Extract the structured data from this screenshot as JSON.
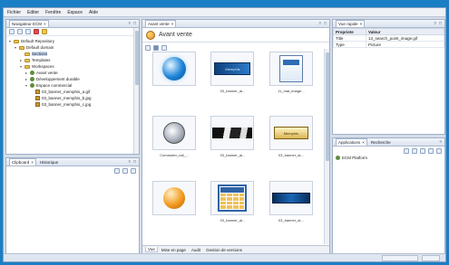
{
  "menubar": {
    "items": [
      "Fichier",
      "Editer",
      "Fenêtre",
      "Espace",
      "Aide"
    ]
  },
  "left_top": {
    "tab_label": "Navigateur ECM",
    "tree": [
      {
        "label": "Default Repository",
        "depth": 0,
        "twisty": "▾",
        "icon": "folder-icon"
      },
      {
        "label": "Default domain",
        "depth": 1,
        "twisty": "▾",
        "icon": "folder-icon"
      },
      {
        "label": "Sections",
        "depth": 2,
        "twisty": "",
        "icon": "folder-icon",
        "selected": true
      },
      {
        "label": "Templates",
        "depth": 2,
        "twisty": "▸",
        "icon": "folder-icon"
      },
      {
        "label": "Workspaces",
        "depth": 2,
        "twisty": "▾",
        "icon": "folder-icon"
      },
      {
        "label": "Avant vente",
        "depth": 3,
        "twisty": "▸",
        "icon": "gear-icon"
      },
      {
        "label": "Développement durable",
        "depth": 3,
        "twisty": "▸",
        "icon": "gear-icon"
      },
      {
        "label": "Espace commercial",
        "depth": 3,
        "twisty": "▾",
        "icon": "gear-icon"
      },
      {
        "label": "03_banner_memphis_a.gif",
        "depth": 4,
        "twisty": "",
        "icon": "image-icon"
      },
      {
        "label": "03_banner_memphis_b.jpg",
        "depth": 4,
        "twisty": "",
        "icon": "image-icon"
      },
      {
        "label": "03_banner_memphis_c.jpg",
        "depth": 4,
        "twisty": "",
        "icon": "image-icon"
      }
    ]
  },
  "left_bottom": {
    "tabs": [
      "Clipboard",
      "Historique"
    ]
  },
  "center": {
    "tab_label": "Avant vente",
    "title": "Avant vente",
    "thumbnails": [
      {
        "kind": "sphere",
        "caption": ""
      },
      {
        "kind": "banner",
        "caption": "03_banner_ai...",
        "banner_text": "Memphis"
      },
      {
        "kind": "doc",
        "caption": "11_mat_image..."
      },
      {
        "kind": "disc",
        "caption": "Commuter_rail_..."
      },
      {
        "kind": "bwbar",
        "caption": "03_banner_ai..."
      },
      {
        "kind": "goldplate",
        "caption": "03_banner_ai...",
        "banner_text": "Memphis"
      },
      {
        "kind": "orb",
        "caption": ""
      },
      {
        "kind": "calwin",
        "caption": "03_banner_ai..."
      },
      {
        "kind": "bluebar",
        "caption": "03_banner_ai..."
      }
    ],
    "bottom_tabs": [
      "Vue",
      "Mise en page",
      "Audit",
      "Gestion de versions"
    ]
  },
  "right_top": {
    "tab_label": "Vue rapide",
    "columns": [
      "Propriete",
      "Valeur"
    ],
    "rows": [
      [
        "Title",
        "13_search_point_image.gif"
      ],
      [
        "Type",
        "Picture"
      ]
    ]
  },
  "right_bottom": {
    "tabs": [
      "Applications",
      "Recherche"
    ],
    "tree": [
      {
        "label": "ECM Platform"
      }
    ]
  },
  "status_bar": {
    "segments": [
      "",
      ""
    ]
  }
}
